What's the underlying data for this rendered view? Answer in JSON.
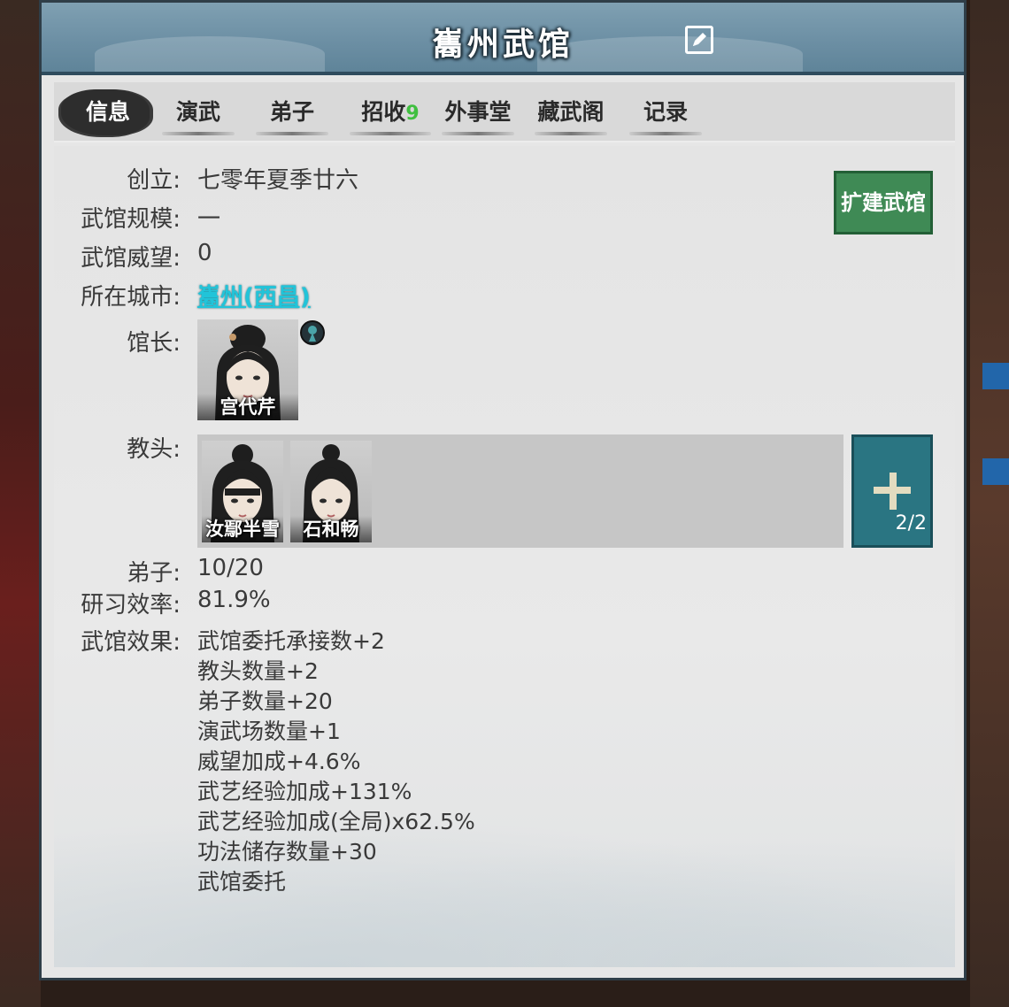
{
  "window": {
    "title": "巂州武馆"
  },
  "tabs": [
    {
      "label": "信息"
    },
    {
      "label": "演武"
    },
    {
      "label": "弟子"
    },
    {
      "label": "招收",
      "badge": "9"
    },
    {
      "label": "外事堂"
    },
    {
      "label": "藏武阁"
    },
    {
      "label": "记录"
    }
  ],
  "info": {
    "founded_label": "创立:",
    "founded_value": "七零年夏季廿六",
    "scale_label": "武馆规模:",
    "scale_value": "一",
    "prestige_label": "武馆威望:",
    "prestige_value": "0",
    "city_label": "所在城市:",
    "city_value": "巂州(西昌)",
    "master_label": "馆长:",
    "master_name": "宫代芹",
    "instructors_label": "教头:",
    "instructors": [
      {
        "name": "汝鄢半雪"
      },
      {
        "name": "石和畅"
      }
    ],
    "instructor_capacity": "2/2",
    "disciples_label": "弟子:",
    "disciples_value": "10/20",
    "efficiency_label": "研习效率:",
    "efficiency_value": "81.9%",
    "effects_label": "武馆效果:",
    "effects": [
      "武馆委托承接数+2",
      "教头数量+2",
      "弟子数量+20",
      "演武场数量+1",
      "威望加成+4.6%",
      "武艺经验加成+131%",
      "武艺经验加成(全局)x62.5%",
      "功法储存数量+30",
      "武馆委托"
    ]
  },
  "buttons": {
    "expand": "扩建武馆"
  },
  "colors": {
    "title_bar": "#6b8ea3",
    "link": "#21c4d9",
    "expand_button": "#3f8a55",
    "add_button": "#2a7582",
    "badge": "#3fbf3f"
  },
  "icons": [
    "edit-icon",
    "gender-female-icon",
    "plus-icon"
  ]
}
